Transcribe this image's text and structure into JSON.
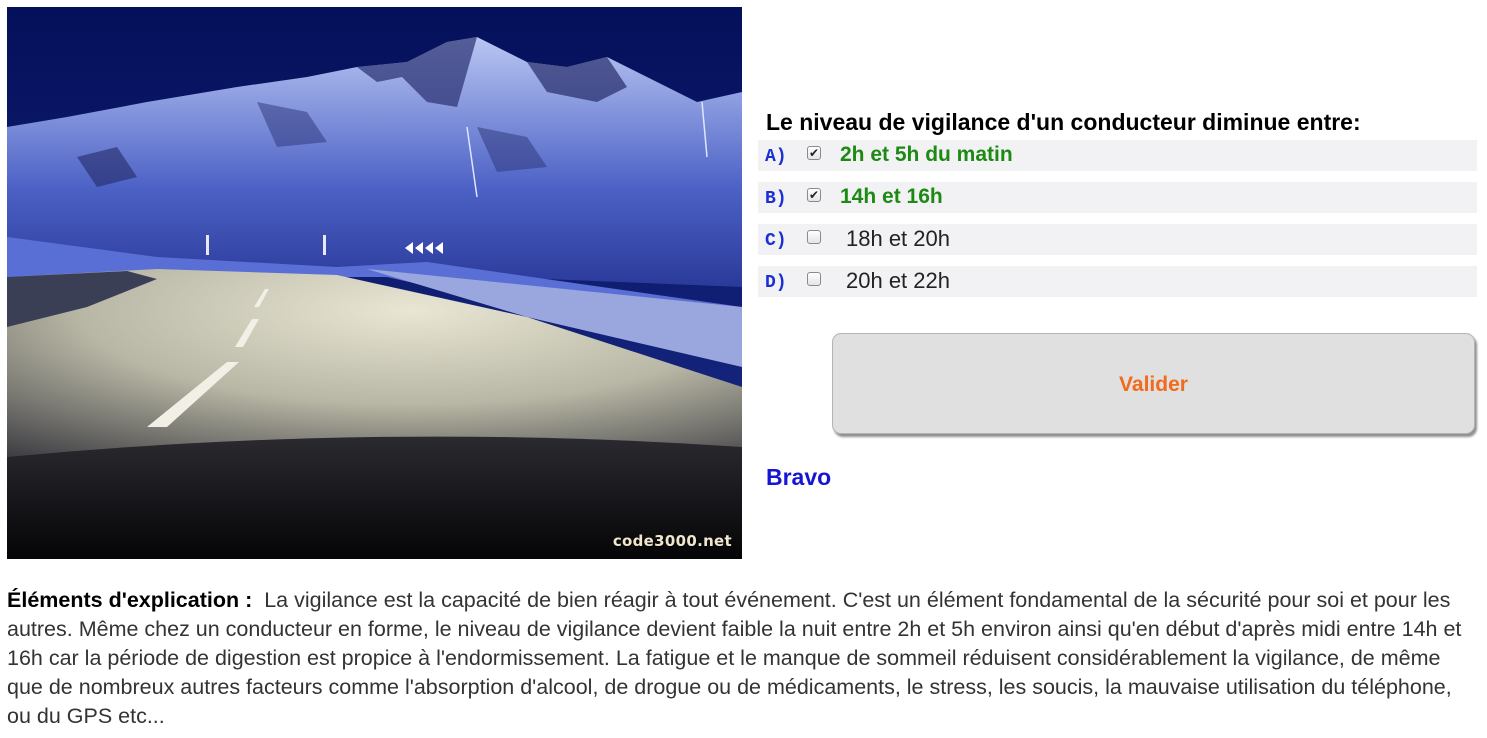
{
  "image": {
    "watermark": "code3000.net"
  },
  "question": {
    "text": "Le niveau de vigilance d'un conducteur diminue entre:",
    "options": [
      {
        "letter": "A)",
        "label": "2h et 5h du matin",
        "checked": true,
        "correct": true
      },
      {
        "letter": "B)",
        "label": "14h et 16h",
        "checked": true,
        "correct": true
      },
      {
        "letter": "C)",
        "label": "18h et 20h",
        "checked": false,
        "correct": false
      },
      {
        "letter": "D)",
        "label": "20h et 22h",
        "checked": false,
        "correct": false
      }
    ]
  },
  "validate_label": "Valider",
  "feedback": "Bravo",
  "explanation": {
    "label": "Éléments d'explication :",
    "text": "La vigilance est la capacité de bien réagir à tout événement. C'est un élément fondamental de la sécurité pour soi et pour les autres. Même chez un conducteur en forme, le niveau de vigilance devient faible la nuit entre 2h et 5h environ ainsi qu'en début d'après midi entre 14h et 16h car la période de digestion est propice à l'endormissement. La fatigue et le manque de sommeil réduisent considérablement la vigilance, de même que de nombreux autres facteurs comme l'absorption d'alcool, de drogue ou de médicaments, le stress, les soucis, la mauvaise utilisation du téléphone, ou du GPS etc..."
  },
  "colors": {
    "correct": "#1d8a14",
    "letter": "#1a2fd6",
    "button_text": "#f26a1b",
    "feedback": "#1515d6"
  }
}
